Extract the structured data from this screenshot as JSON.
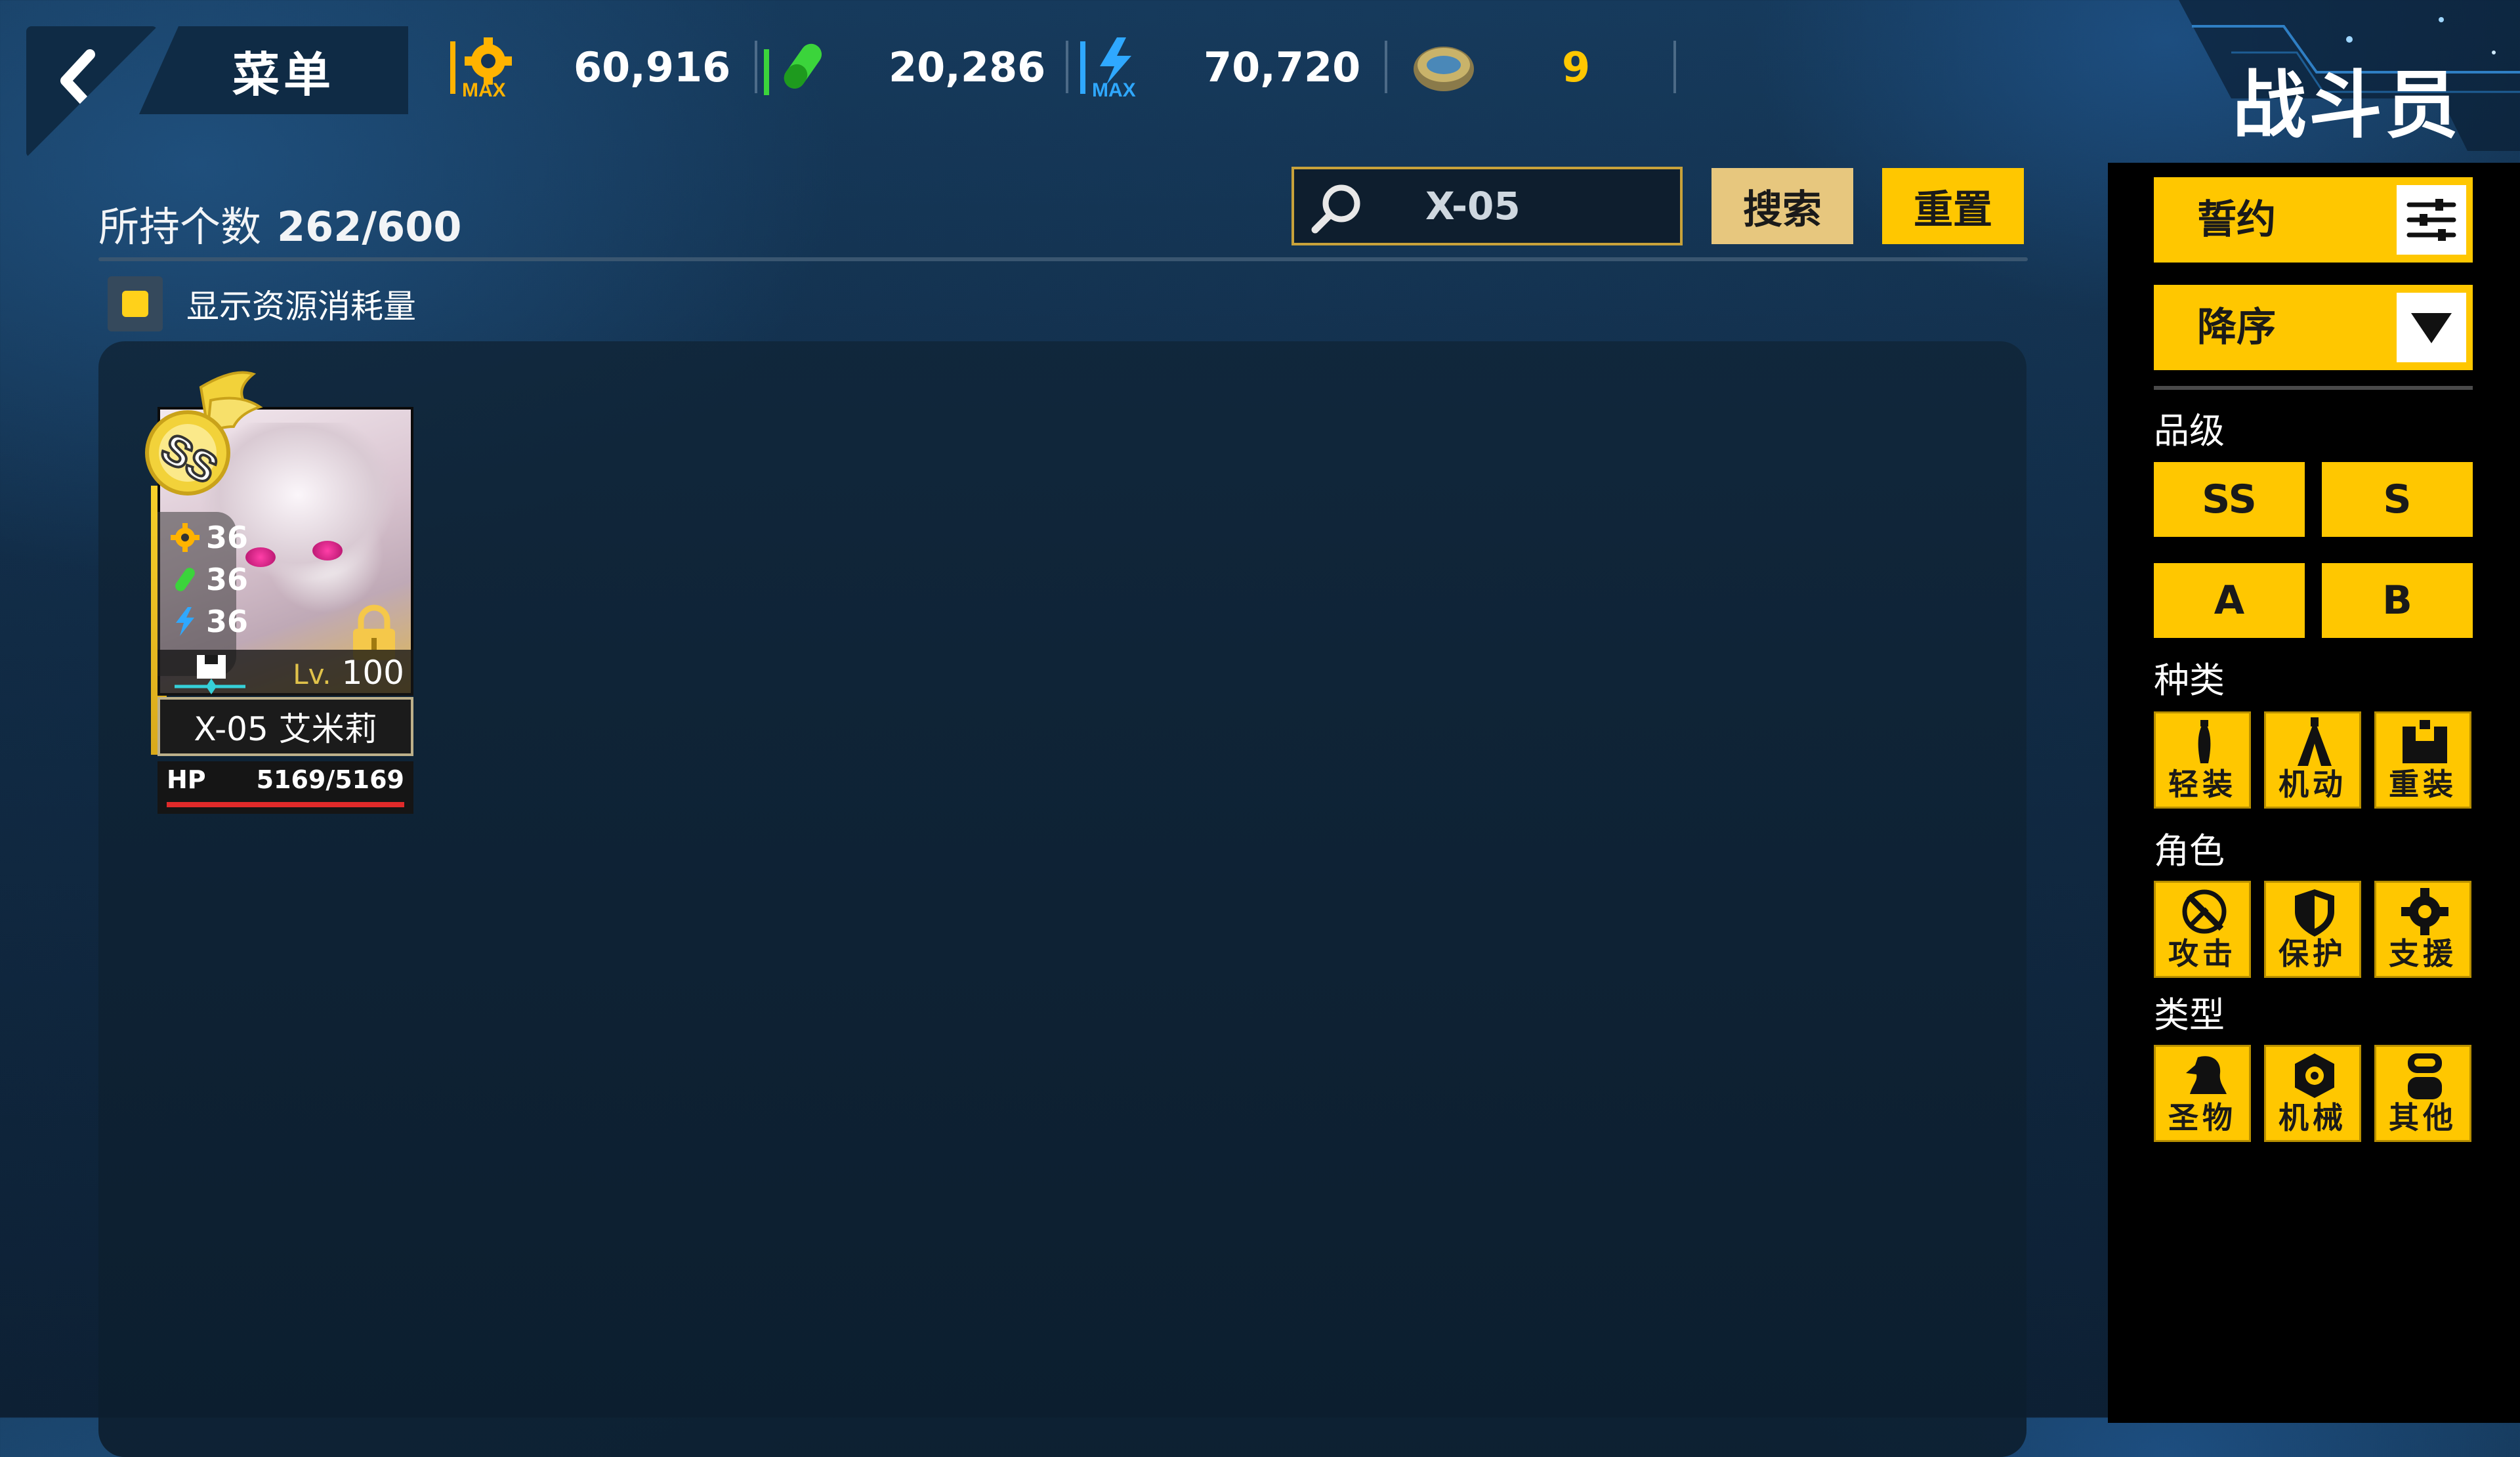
{
  "header": {
    "menu_label": "菜单",
    "page_title": "战斗员",
    "resources": [
      {
        "name": "parts",
        "icon": "gear-max-icon",
        "value": "60,916"
      },
      {
        "name": "nutrient",
        "icon": "capsule-icon",
        "value": "20,286"
      },
      {
        "name": "power",
        "icon": "lightning-max-icon",
        "value": "70,720"
      },
      {
        "name": "tuna",
        "icon": "tuna-can-icon",
        "value": "9"
      }
    ],
    "max_label": "MAX"
  },
  "inventory": {
    "owned_label": "所持个数",
    "owned_count": "262/600",
    "show_resource_label": "显示资源消耗量",
    "show_resource_checked": true
  },
  "search": {
    "value": "X-05",
    "search_label": "搜索",
    "reset_label": "重置"
  },
  "card": {
    "name": "X-05 艾米莉",
    "level_prefix": "Lv.",
    "level": "100",
    "stats": [
      "36",
      "36",
      "36"
    ],
    "hp_label": "HP",
    "hp_value": "5169/5169",
    "hp_fraction": 1.0,
    "grade": "SS",
    "locked": true
  },
  "sidebar": {
    "sort_field": "誓约",
    "sort_order": "降序",
    "grade_label": "品级",
    "grades": [
      "SS",
      "S",
      "A",
      "B"
    ],
    "class_label": "种类",
    "classes": [
      {
        "label": "轻装",
        "icon": "light-armor-icon"
      },
      {
        "label": "机动",
        "icon": "mobility-icon"
      },
      {
        "label": "重装",
        "icon": "heavy-armor-icon"
      }
    ],
    "role_label": "角色",
    "roles": [
      {
        "label": "攻击",
        "icon": "attack-icon"
      },
      {
        "label": "保护",
        "icon": "shield-icon"
      },
      {
        "label": "支援",
        "icon": "support-gear-icon"
      }
    ],
    "type_label": "类型",
    "types": [
      {
        "label": "圣物",
        "icon": "bioroid-icon"
      },
      {
        "label": "机械",
        "icon": "machine-icon"
      },
      {
        "label": "其他",
        "icon": "other-icon"
      }
    ]
  },
  "colors": {
    "accent": "#ffc700",
    "panel": "#0f2b45",
    "background": "#112b45"
  }
}
